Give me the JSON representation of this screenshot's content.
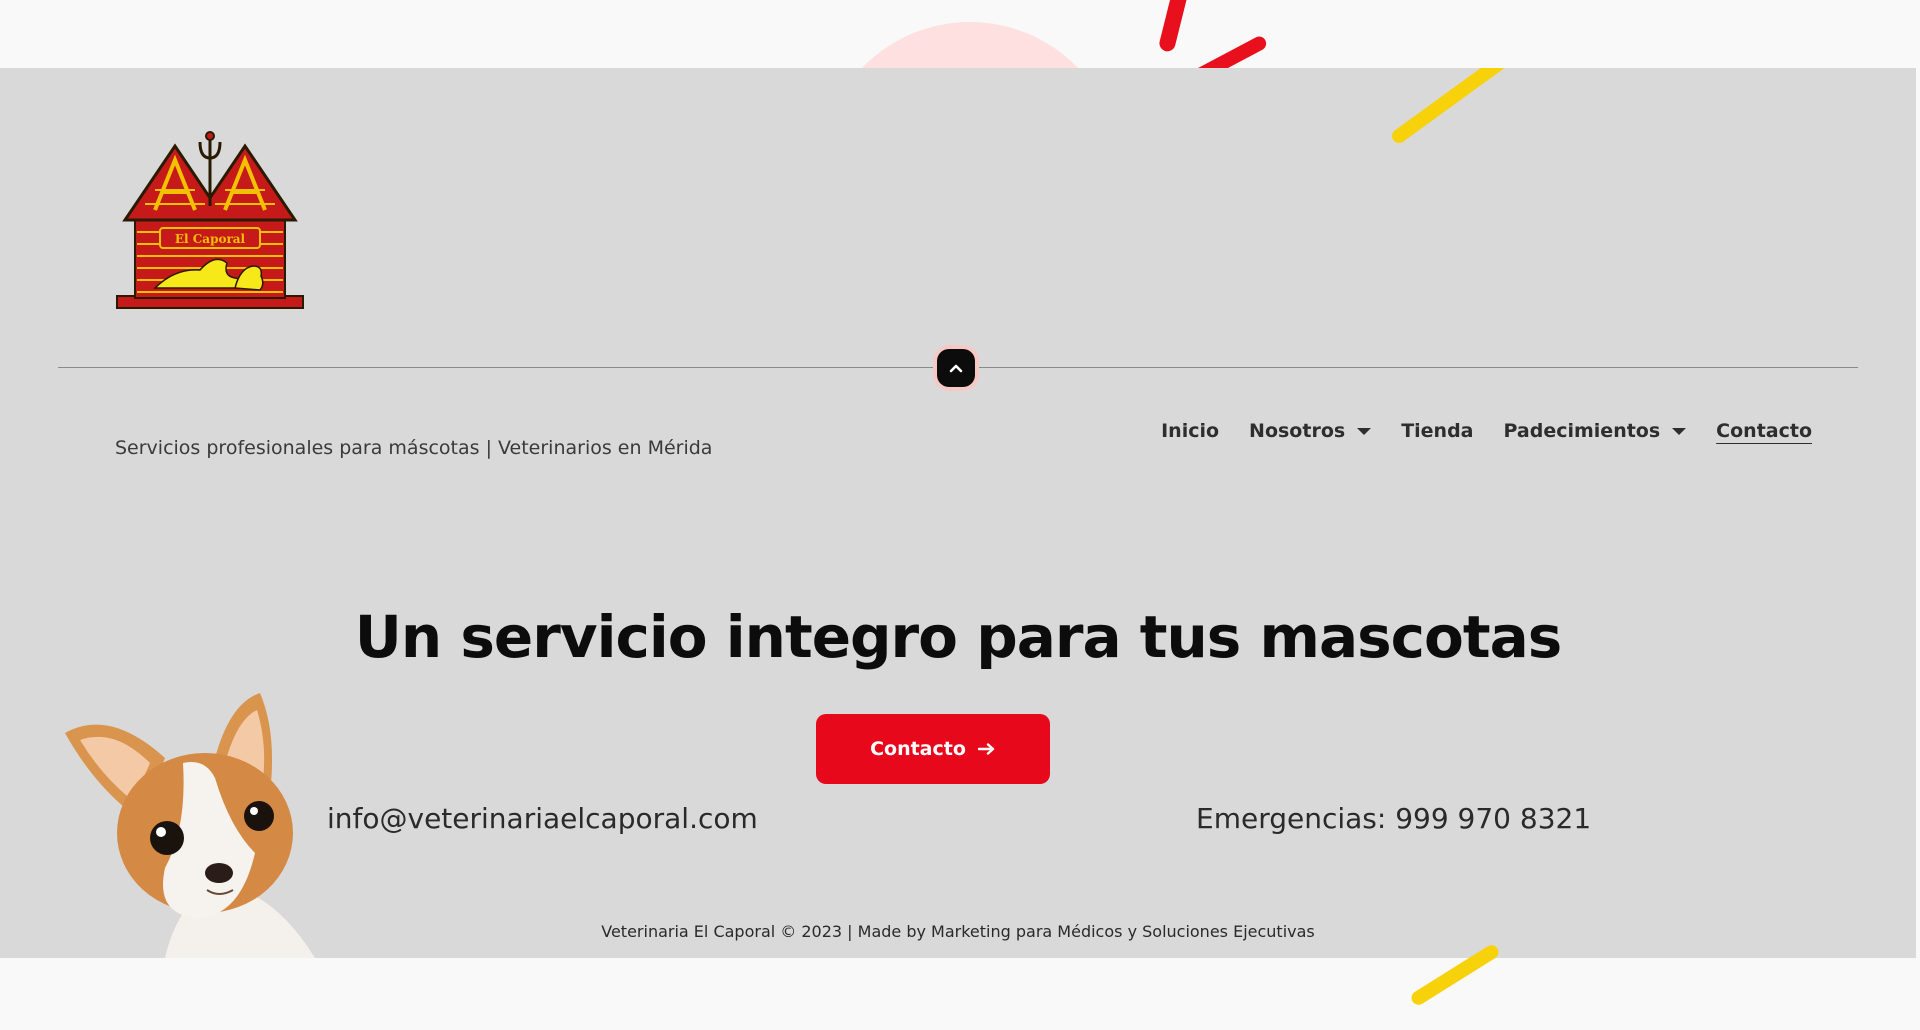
{
  "header": {
    "logo_label": "El Caporal",
    "tagline": "Servicios profesionales para máscotas | Veterinarios en Mérida"
  },
  "nav": {
    "items": [
      {
        "label": "Inicio",
        "has_dropdown": false,
        "active": false
      },
      {
        "label": "Nosotros",
        "has_dropdown": true,
        "active": false
      },
      {
        "label": "Tienda",
        "has_dropdown": false,
        "active": false
      },
      {
        "label": "Padecimientos",
        "has_dropdown": true,
        "active": false
      },
      {
        "label": "Contacto",
        "has_dropdown": false,
        "active": true
      }
    ]
  },
  "scroll_top": {
    "icon": "chevron-up-icon"
  },
  "hero": {
    "headline": "Un servicio integro para tus mascotas",
    "email": "info@veterinariaelcaporal.com",
    "cta_label": "Contacto",
    "cta_icon": "arrow-right-icon",
    "emergency": "Emergencias: 999 970 8321"
  },
  "footer": {
    "copyright": "Veterinaria El Caporal © 2023  |  Made by Marketing para Médicos y Soluciones Ejecutivas"
  },
  "colors": {
    "band_background": "#d9d9d9",
    "page_background": "#f9f9f9",
    "accent_red": "#e8081c",
    "accent_yellow": "#f7d20a",
    "accent_pink": "#ffe0e0",
    "text_dark": "#0c0c0c"
  }
}
